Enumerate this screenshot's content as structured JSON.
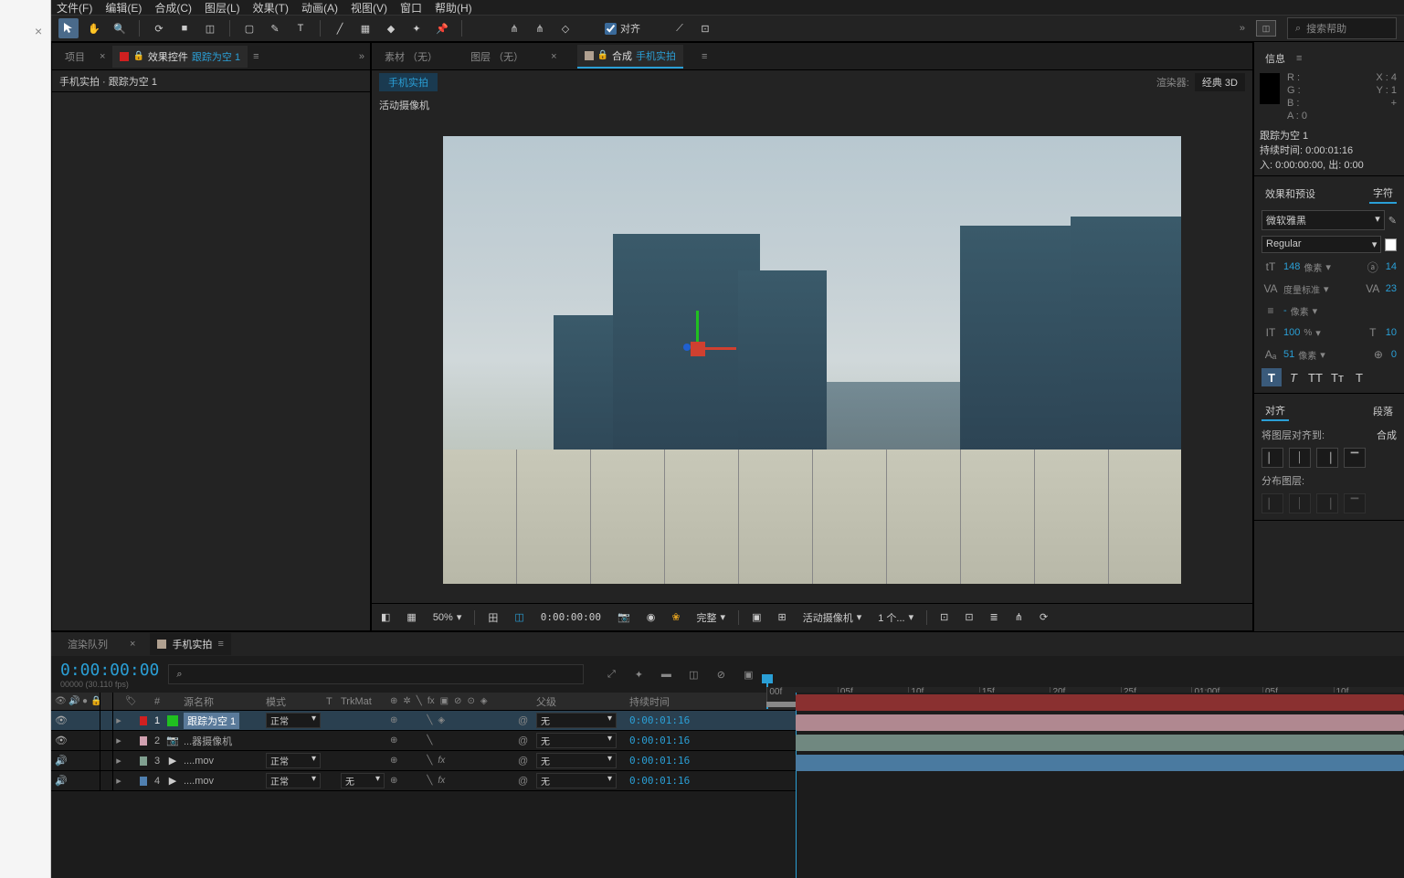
{
  "menubar": [
    "文件(F)",
    "编辑(E)",
    "合成(C)",
    "图层(L)",
    "效果(T)",
    "动画(A)",
    "视图(V)",
    "窗口",
    "帮助(H)"
  ],
  "toolbar": {
    "align_label": "对齐",
    "search_placeholder": "搜索帮助"
  },
  "project": {
    "tab_project": "项目",
    "tab_effect_controls": "效果控件",
    "effect_target": "跟踪为空 1",
    "path": "手机实拍 · 跟踪为空 1"
  },
  "viewer": {
    "tab_material": "素材 （无）",
    "tab_layer": "图层 （无）",
    "tab_comp_prefix": "合成",
    "tab_comp_name": "手机实拍",
    "comp_link": "手机实拍",
    "renderer_label": "渲染器:",
    "renderer_value": "经典 3D",
    "camera_caption": "活动摄像机",
    "footer": {
      "zoom": "50%",
      "time": "0:00:00:00",
      "resolution": "完整",
      "camera": "活动摄像机",
      "views": "1 个..."
    }
  },
  "info": {
    "title": "信息",
    "r": "R :",
    "g": "G :",
    "b": "B :",
    "a": "A : 0",
    "x": "X : 4",
    "y": "Y : 1",
    "layer_name": "跟踪为空 1",
    "duration_label": "持续时间:",
    "duration": "0:00:01:16",
    "in_label": "入:",
    "in": "0:00:00:00,",
    "out_label": "出:",
    "out": "0:00"
  },
  "char": {
    "tab_effects": "效果和预设",
    "tab_char": "字符",
    "font": "微软雅黑",
    "style": "Regular",
    "size": "148",
    "size_unit": "像素",
    "leading": "14",
    "kerning_label": "度量标准",
    "tracking": "23",
    "stroke": "-",
    "stroke_unit": "像素",
    "vscale": "100",
    "vscale_unit": "%",
    "hscale": "10",
    "baseline": "51",
    "baseline_unit": "像素",
    "tsume": "0"
  },
  "align_panel": {
    "tab_align": "对齐",
    "tab_para": "段落",
    "align_to_label": "将图层对齐到:",
    "align_to": "合成",
    "distribute_label": "分布图层:"
  },
  "timeline": {
    "tab_render": "渲染队列",
    "tab_comp": "手机实拍",
    "timecode": "0:00:00:00",
    "timecode_sub": "00000 (30.110 fps)",
    "ruler": [
      "00f",
      "05f",
      "10f",
      "15f",
      "20f",
      "25f",
      "01:00f",
      "05f",
      "10f"
    ],
    "columns": {
      "num": "#",
      "name": "源名称",
      "mode": "模式",
      "t": "T",
      "trkmat": "TrkMat",
      "parent": "父级",
      "duration": "持续时间"
    },
    "mode_normal": "正常",
    "parent_none": "无",
    "layers": [
      {
        "num": "1",
        "name": "跟踪为空 1",
        "duration": "0:00:01:16",
        "color": "#d02020",
        "type_color": "#20c020",
        "mode": true,
        "selected": true,
        "is3d": true,
        "fx": false,
        "eye": true
      },
      {
        "num": "2",
        "name": "...器摄像机",
        "duration": "0:00:01:16",
        "color": "#d0a0b0",
        "mode": false,
        "selected": false,
        "cam": true,
        "eye": true
      },
      {
        "num": "3",
        "name": "....mov",
        "duration": "0:00:01:16",
        "color": "#80a090",
        "mode": true,
        "selected": false,
        "fx": true,
        "audio": true
      },
      {
        "num": "4",
        "name": "....mov",
        "duration": "0:00:01:16",
        "color": "#5080b0",
        "mode": true,
        "selected": false,
        "fx": true,
        "audio": true
      }
    ]
  }
}
